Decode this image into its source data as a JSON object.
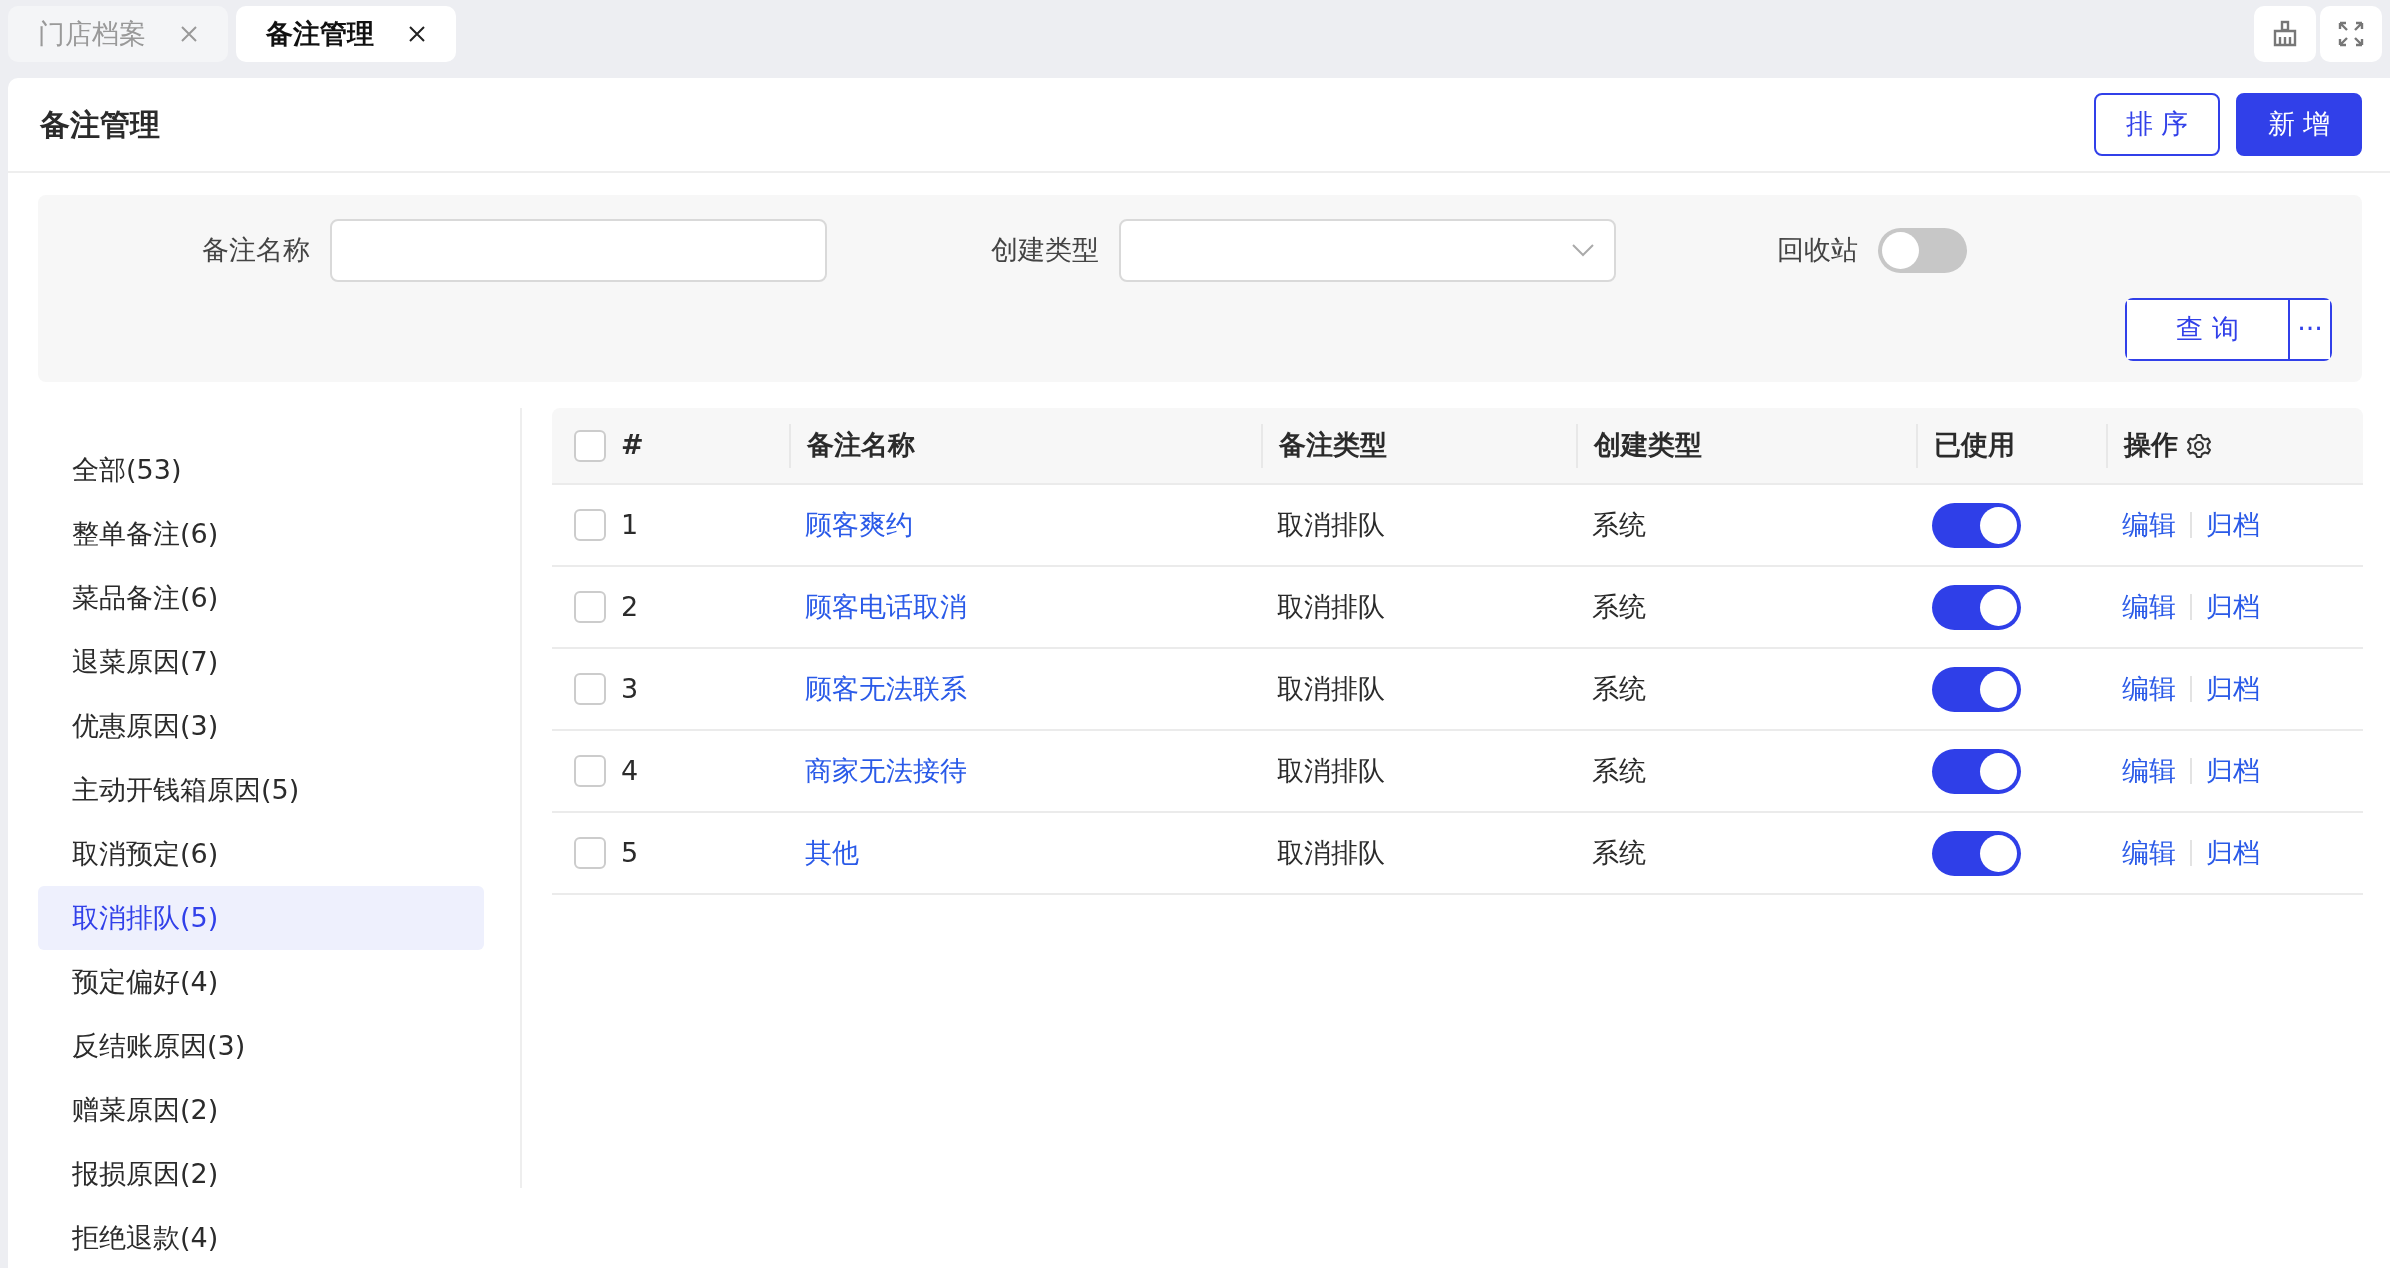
{
  "tabs": [
    {
      "label": "门店档案",
      "selected": false
    },
    {
      "label": "备注管理",
      "selected": true
    }
  ],
  "page": {
    "title": "备注管理",
    "buttons": [
      {
        "label": "排 序",
        "kind": "outline"
      },
      {
        "label": "新 增",
        "kind": "primary"
      }
    ]
  },
  "filters": {
    "fields": [
      {
        "label": "备注名称",
        "kind": "text"
      },
      {
        "label": "创建类型",
        "kind": "select"
      },
      {
        "label": "回收站",
        "kind": "switch",
        "on": false
      }
    ],
    "query_button": "查 询",
    "more_button": "···"
  },
  "sidebar": {
    "items": [
      {
        "label": "全部(53)",
        "selected": false
      },
      {
        "label": "整单备注(6)",
        "selected": false
      },
      {
        "label": "菜品备注(6)",
        "selected": false
      },
      {
        "label": "退菜原因(7)",
        "selected": false
      },
      {
        "label": "优惠原因(3)",
        "selected": false
      },
      {
        "label": "主动开钱箱原因(5)",
        "selected": false
      },
      {
        "label": "取消预定(6)",
        "selected": false
      },
      {
        "label": "取消排队(5)",
        "selected": true
      },
      {
        "label": "预定偏好(4)",
        "selected": false
      },
      {
        "label": "反结账原因(3)",
        "selected": false
      },
      {
        "label": "赠菜原因(2)",
        "selected": false
      },
      {
        "label": "报损原因(2)",
        "selected": false
      },
      {
        "label": "拒绝退款(4)",
        "selected": false
      }
    ]
  },
  "table": {
    "select_all_checked": false,
    "columns": [
      "#",
      "备注名称",
      "备注类型",
      "创建类型",
      "已使用",
      "操作"
    ],
    "rows": [
      {
        "index": "1",
        "name": "顾客爽约",
        "type": "取消排队",
        "created": "系统",
        "checked": false,
        "used": true,
        "actions": [
          "编辑",
          "归档"
        ]
      },
      {
        "index": "2",
        "name": "顾客电话取消",
        "type": "取消排队",
        "created": "系统",
        "checked": false,
        "used": true,
        "actions": [
          "编辑",
          "归档"
        ]
      },
      {
        "index": "3",
        "name": "顾客无法联系",
        "type": "取消排队",
        "created": "系统",
        "checked": false,
        "used": true,
        "actions": [
          "编辑",
          "归档"
        ]
      },
      {
        "index": "4",
        "name": "商家无法接待",
        "type": "取消排队",
        "created": "系统",
        "checked": false,
        "used": true,
        "actions": [
          "编辑",
          "归档"
        ]
      },
      {
        "index": "5",
        "name": "其他",
        "type": "取消排队",
        "created": "系统",
        "checked": false,
        "used": true,
        "actions": [
          "编辑",
          "归档"
        ]
      }
    ]
  }
}
